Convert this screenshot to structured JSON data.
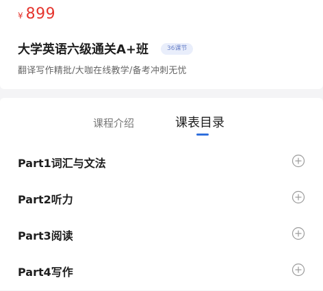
{
  "course": {
    "price_symbol": "¥",
    "price": "899",
    "title": "大学英语六级通关A+班",
    "lesson_badge": "36课节",
    "subtitle": "翻译写作精批/大咖在线教学/备考冲刺无忧"
  },
  "tabs": [
    {
      "label": "课程介绍",
      "active": false
    },
    {
      "label": "课表目录",
      "active": true
    }
  ],
  "chapters": [
    {
      "title": "Part1词汇与文法",
      "icon": "plus-circle-icon"
    },
    {
      "title": "Part2听力",
      "icon": "plus-circle-icon"
    },
    {
      "title": "Part3阅读",
      "icon": "plus-circle-icon"
    },
    {
      "title": "Part4写作",
      "icon": "plus-circle-icon"
    }
  ],
  "colors": {
    "price": "#e5352e",
    "accent": "#2f6fdc",
    "badge_text": "#6b83c9",
    "badge_bg": "#e9eefb",
    "page_bg": "#f4f4f6"
  }
}
